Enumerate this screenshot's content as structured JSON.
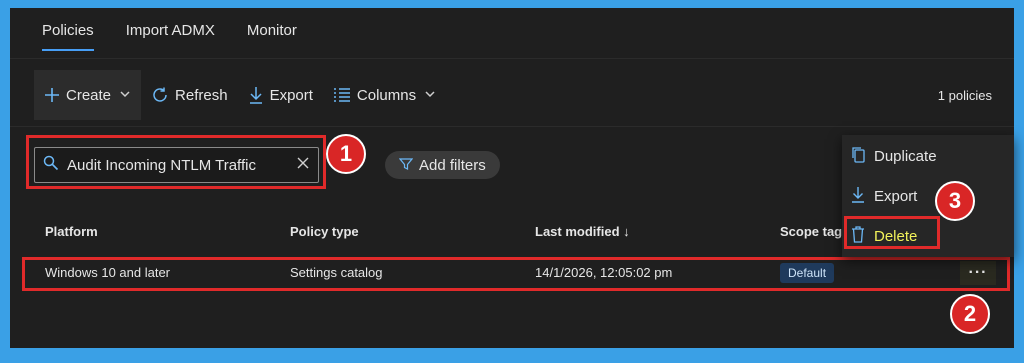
{
  "tabs": [
    {
      "label": "Policies",
      "active": true
    },
    {
      "label": "Import ADMX",
      "active": false
    },
    {
      "label": "Monitor",
      "active": false
    }
  ],
  "toolbar": {
    "create_label": "Create",
    "refresh_label": "Refresh",
    "export_label": "Export",
    "columns_label": "Columns",
    "count_label": "1 policies"
  },
  "search": {
    "value": "Audit Incoming NTLM Traffic"
  },
  "filters": {
    "label": "Add filters"
  },
  "table": {
    "headers": [
      "Platform",
      "Policy type",
      "Last modified ↓",
      "Scope tag"
    ],
    "rows": [
      {
        "platform": "Windows 10 and later",
        "policy_type": "Settings catalog",
        "last_modified": "14/1/2026, 12:05:02 pm",
        "scope_tag": "Default",
        "more": "···"
      }
    ]
  },
  "context_menu": {
    "items": [
      "Duplicate",
      "Export",
      "Delete"
    ]
  },
  "annotations": [
    "1",
    "2",
    "3"
  ],
  "colors": {
    "accent": "#479ef5",
    "highlight": "#e02a2a",
    "delete_text": "#f2f25a",
    "background": "#1f1f1f",
    "outer_border": "#3aa0e6"
  }
}
